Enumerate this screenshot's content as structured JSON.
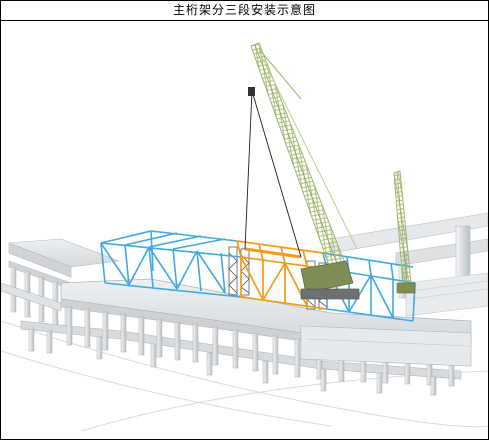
{
  "title": "主桁架分三段安装示意图",
  "colors": {
    "truss_side_segments": "#3fa9e0",
    "truss_middle_segment": "#f39a1b",
    "crane_boom": "#bcd08c",
    "concrete": "#dfe3e6",
    "temporary_support": "#55585c"
  },
  "illustration": {
    "subject": "main-truss-three-segment-installation",
    "segments": [
      "left-segment",
      "middle-segment",
      "right-segment"
    ],
    "equipment": [
      "main-crawler-crane",
      "secondary-crane",
      "temporary-support-towers"
    ]
  }
}
